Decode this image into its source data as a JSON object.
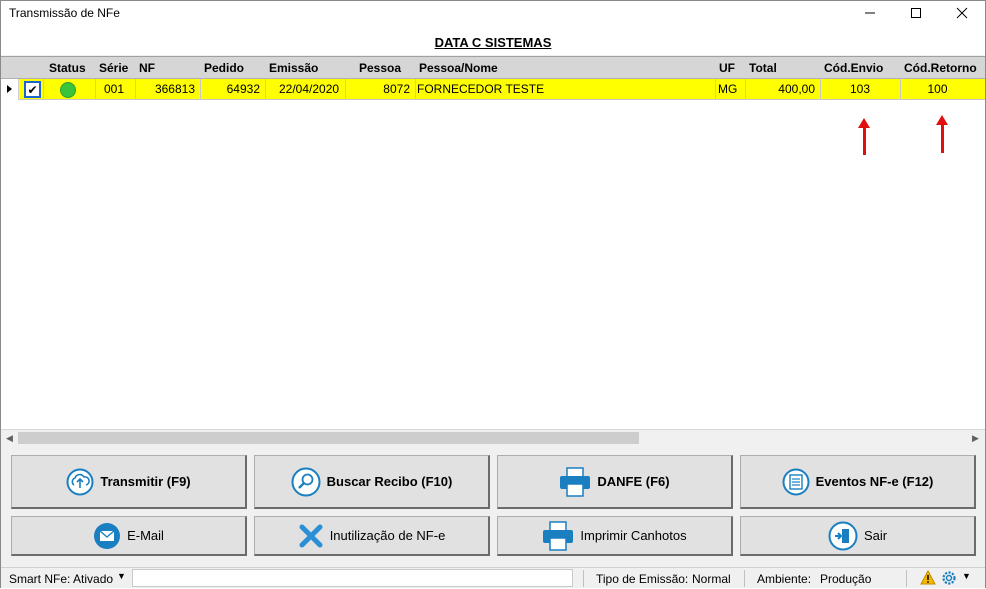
{
  "window": {
    "title": "Transmissão de NFe",
    "minimize": "—",
    "maximize": "☐",
    "close": "✕"
  },
  "heading": "DATA C SISTEMAS",
  "grid": {
    "columns": [
      "Status",
      "Série",
      "NF",
      "Pedido",
      "Emissão",
      "Pessoa",
      "Pessoa/Nome",
      "UF",
      "Total",
      "Cód.Envio",
      "Cód.Retorno"
    ],
    "rows": [
      {
        "checked": "✔",
        "status_color": "#39c439",
        "serie": "001",
        "nf": "366813",
        "pedido": "64932",
        "emissao": "22/04/2020",
        "pessoa": "8072",
        "pessoa_nome": "FORNECEDOR TESTE",
        "uf": "MG",
        "total": "400,00",
        "cod_envio": "103",
        "cod_retorno": "100"
      }
    ]
  },
  "buttons": {
    "transmitir": "Transmitir (F9)",
    "buscar_recibo": "Buscar Recibo (F10)",
    "danfe": "DANFE (F6)",
    "eventos": "Eventos NF-e (F12)",
    "email": "E-Mail",
    "inutilizacao": "Inutilização de NF-e",
    "imprimir_canhotos": "Imprimir Canhotos",
    "sair": "Sair"
  },
  "statusbar": {
    "smart_nfe": "Smart NFe: Ativado",
    "tipo_emissao_label": "Tipo de Emissão:",
    "tipo_emissao_value": "Normal",
    "ambiente_label": "Ambiente:",
    "ambiente_value": "Produção"
  },
  "colors": {
    "row_highlight": "#ffff00",
    "accent_blue": "#1a7fc0",
    "arrow_red": "#e01010"
  }
}
